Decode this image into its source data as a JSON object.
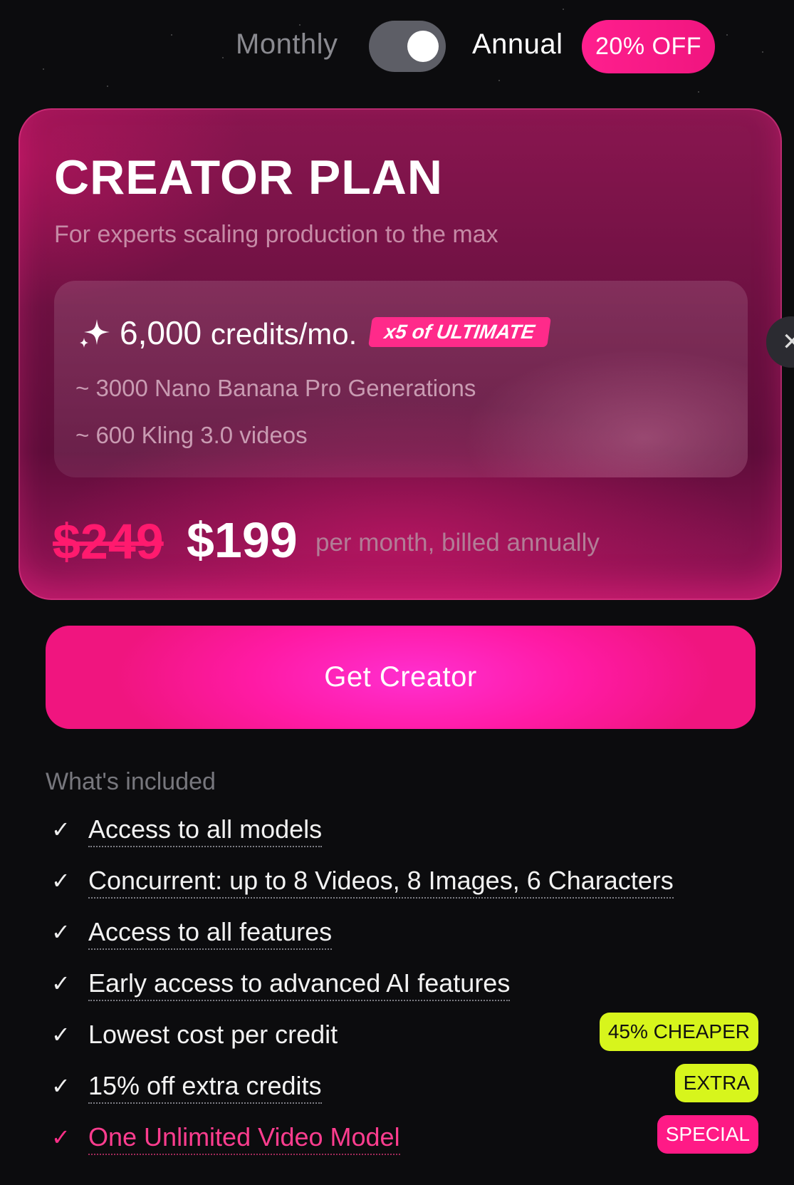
{
  "billing": {
    "monthly_label": "Monthly",
    "annual_label": "Annual",
    "discount_badge": "20% OFF",
    "selected": "Annual"
  },
  "plan": {
    "title": "CREATOR PLAN",
    "subtitle": "For experts scaling production to the max",
    "credits": {
      "amount": "6,000",
      "unit": "credits/mo.",
      "badge": "x5 of ULTIMATE",
      "lines": [
        "~ 3000 Nano Banana Pro Generations",
        "~ 600 Kling 3.0 videos"
      ]
    },
    "old_price": "$249",
    "price": "$199",
    "price_note": "per month, billed annually"
  },
  "cta": {
    "label": "Get Creator"
  },
  "next_icon": "chevron-right-icon",
  "included": {
    "title": "What's included",
    "features": [
      {
        "text": "Access to all models",
        "tag": ""
      },
      {
        "text": "Concurrent: up to 8 Videos, 8 Images, 6 Characters",
        "tag": ""
      },
      {
        "text": "Access to all features",
        "tag": ""
      },
      {
        "text": "Early access to advanced AI features",
        "tag": ""
      },
      {
        "text": "Lowest cost per credit",
        "tag": "45% CHEAPER"
      },
      {
        "text": "15% off extra credits",
        "tag": "EXTRA"
      },
      {
        "text": "One Unlimited Video Model",
        "tag": "SPECIAL"
      }
    ]
  },
  "colors": {
    "accent_pink": "#ff1a86",
    "tag_green": "#d7f51c",
    "old_price_red": "#ff1a6e"
  }
}
